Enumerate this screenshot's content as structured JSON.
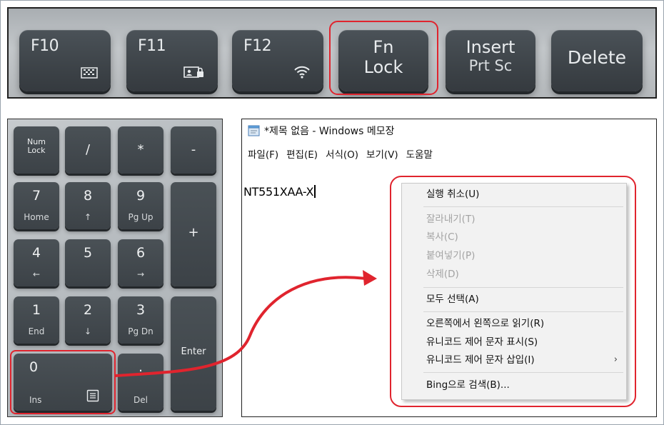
{
  "top_keys": {
    "f10": "F10",
    "f11": "F11",
    "f12": "F12",
    "fn_lock_line1": "Fn",
    "fn_lock_line2": "Lock",
    "insert_line1": "Insert",
    "insert_line2": "Prt Sc",
    "delete": "Delete"
  },
  "numpad": {
    "numlock_line1": "Num",
    "numlock_line2": "Lock",
    "slash": "/",
    "asterisk": "*",
    "minus": "-",
    "k7": "7",
    "k7_sub": "Home",
    "k8": "8",
    "k8_sub": "↑",
    "k9": "9",
    "k9_sub": "Pg Up",
    "plus": "+",
    "k4": "4",
    "k4_sub": "←",
    "k5": "5",
    "k6": "6",
    "k6_sub": "→",
    "k1": "1",
    "k1_sub": "End",
    "k2": "2",
    "k2_sub": "↓",
    "k3": "3",
    "k3_sub": "Pg Dn",
    "enter": "Enter",
    "k0": "0",
    "k0_sub": "Ins",
    "dot": ".",
    "dot_sub": "Del"
  },
  "notepad": {
    "title": "*제목 없음 - Windows 메모장",
    "menu": [
      "파일(F)",
      "편집(E)",
      "서식(O)",
      "보기(V)",
      "도움말"
    ],
    "text": "NT551XAA-X"
  },
  "context_menu": {
    "undo": "실행 취소(U)",
    "cut": "잘라내기(T)",
    "copy": "복사(C)",
    "paste": "붙여넣기(P)",
    "delete": "삭제(D)",
    "select_all": "모두 선택(A)",
    "rtl": "오른쪽에서 왼쪽으로 읽기(R)",
    "show_unicode": "유니코드 제어 문자 표시(S)",
    "insert_unicode": "유니코드 제어 문자 삽입(I)",
    "submenu_arrow": "›",
    "bing": "Bing으로 검색(B)..."
  },
  "colors": {
    "highlight": "#e0242e",
    "key_face": "#3d4348",
    "disabled_text": "#a3a3a3"
  }
}
